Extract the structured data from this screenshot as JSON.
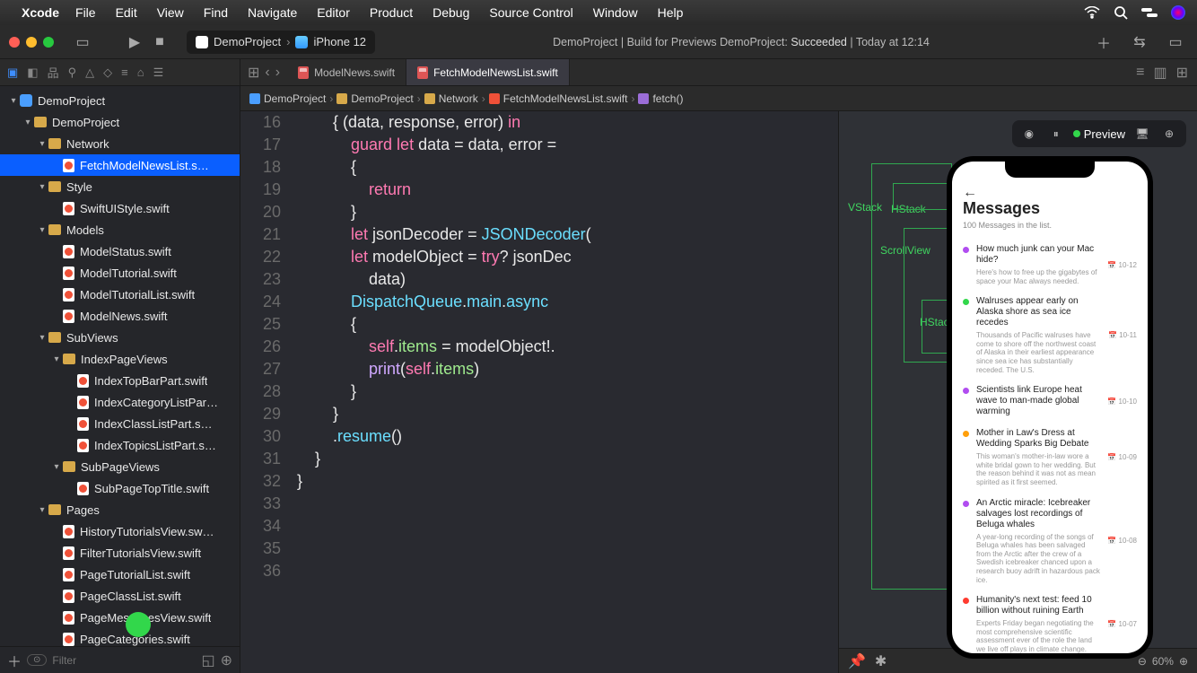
{
  "menubar": {
    "app": "Xcode",
    "items": [
      "File",
      "Edit",
      "View",
      "Find",
      "Navigate",
      "Editor",
      "Product",
      "Debug",
      "Source Control",
      "Window",
      "Help"
    ]
  },
  "toolbar": {
    "scheme_project": "DemoProject",
    "scheme_device": "iPhone 12",
    "status_left": "DemoProject | Build for Previews DemoProject:",
    "status_result": "Succeeded",
    "status_sep": "|",
    "status_time": "Today at 12:14"
  },
  "tabs": {
    "inactive": "ModelNews.swift",
    "active": "FetchModelNewsList.swift"
  },
  "breadcrumb": {
    "items": [
      "DemoProject",
      "DemoProject",
      "Network",
      "FetchModelNewsList.swift",
      "fetch()"
    ]
  },
  "tree": [
    {
      "d": 0,
      "t": "proj",
      "label": "DemoProject",
      "open": true
    },
    {
      "d": 1,
      "t": "folder",
      "label": "DemoProject",
      "open": true
    },
    {
      "d": 2,
      "t": "folder",
      "label": "Network",
      "open": true
    },
    {
      "d": 3,
      "t": "swift",
      "label": "FetchModelNewsList.s…",
      "selected": true
    },
    {
      "d": 2,
      "t": "folder",
      "label": "Style",
      "open": true
    },
    {
      "d": 3,
      "t": "swift",
      "label": "SwiftUIStyle.swift"
    },
    {
      "d": 2,
      "t": "folder",
      "label": "Models",
      "open": true
    },
    {
      "d": 3,
      "t": "swift",
      "label": "ModelStatus.swift"
    },
    {
      "d": 3,
      "t": "swift",
      "label": "ModelTutorial.swift"
    },
    {
      "d": 3,
      "t": "swift",
      "label": "ModelTutorialList.swift"
    },
    {
      "d": 3,
      "t": "swift",
      "label": "ModelNews.swift"
    },
    {
      "d": 2,
      "t": "folder",
      "label": "SubViews",
      "open": true
    },
    {
      "d": 3,
      "t": "folder",
      "label": "IndexPageViews",
      "open": true
    },
    {
      "d": 4,
      "t": "swift",
      "label": "IndexTopBarPart.swift"
    },
    {
      "d": 4,
      "t": "swift",
      "label": "IndexCategoryListPar…"
    },
    {
      "d": 4,
      "t": "swift",
      "label": "IndexClassListPart.s…"
    },
    {
      "d": 4,
      "t": "swift",
      "label": "IndexTopicsListPart.s…"
    },
    {
      "d": 3,
      "t": "folder",
      "label": "SubPageViews",
      "open": true
    },
    {
      "d": 4,
      "t": "swift",
      "label": "SubPageTopTitle.swift"
    },
    {
      "d": 2,
      "t": "folder",
      "label": "Pages",
      "open": true
    },
    {
      "d": 3,
      "t": "swift",
      "label": "HistoryTutorialsView.sw…"
    },
    {
      "d": 3,
      "t": "swift",
      "label": "FilterTutorialsView.swift"
    },
    {
      "d": 3,
      "t": "swift",
      "label": "PageTutorialList.swift"
    },
    {
      "d": 3,
      "t": "swift",
      "label": "PageClassList.swift"
    },
    {
      "d": 3,
      "t": "swift",
      "label": "PageMessagesView.swift"
    },
    {
      "d": 3,
      "t": "swift",
      "label": "PageCategories.swift"
    }
  ],
  "filter_placeholder": "Filter",
  "code": {
    "first_line": 16,
    "lines": [
      [
        {
          "c": "plain",
          "t": "        { (data, response, error) "
        },
        {
          "c": "k-pink",
          "t": "in"
        }
      ],
      [
        {
          "c": "plain",
          "t": "            "
        },
        {
          "c": "k-pink",
          "t": "guard let"
        },
        {
          "c": "plain",
          "t": " data = data, error ="
        }
      ],
      [
        {
          "c": "plain",
          "t": "            {"
        }
      ],
      [
        {
          "c": "plain",
          "t": "                "
        },
        {
          "c": "k-pink",
          "t": "return"
        }
      ],
      [
        {
          "c": "plain",
          "t": "            }"
        }
      ],
      [
        {
          "c": "plain",
          "t": ""
        }
      ],
      [
        {
          "c": "plain",
          "t": "            "
        },
        {
          "c": "k-pink",
          "t": "let"
        },
        {
          "c": "plain",
          "t": " jsonDecoder = "
        },
        {
          "c": "k-teal",
          "t": "JSONDecoder"
        },
        {
          "c": "plain",
          "t": "("
        }
      ],
      [
        {
          "c": "plain",
          "t": "            "
        },
        {
          "c": "k-pink",
          "t": "let"
        },
        {
          "c": "plain",
          "t": " modelObject = "
        },
        {
          "c": "k-pink",
          "t": "try"
        },
        {
          "c": "plain",
          "t": "? jsonDec"
        }
      ],
      [
        {
          "c": "plain",
          "t": "                data)"
        }
      ],
      [
        {
          "c": "plain",
          "t": ""
        }
      ],
      [
        {
          "c": "plain",
          "t": "            "
        },
        {
          "c": "k-teal",
          "t": "DispatchQueue"
        },
        {
          "c": "plain",
          "t": "."
        },
        {
          "c": "k-teal",
          "t": "main"
        },
        {
          "c": "plain",
          "t": "."
        },
        {
          "c": "k-teal",
          "t": "async"
        }
      ],
      [
        {
          "c": "plain",
          "t": "            {"
        }
      ],
      [
        {
          "c": "plain",
          "t": "                "
        },
        {
          "c": "k-pink",
          "t": "self"
        },
        {
          "c": "plain",
          "t": "."
        },
        {
          "c": "k-green",
          "t": "items"
        },
        {
          "c": "plain",
          "t": " = modelObject!."
        }
      ],
      [
        {
          "c": "plain",
          "t": "                "
        },
        {
          "c": "k-purple",
          "t": "print"
        },
        {
          "c": "plain",
          "t": "("
        },
        {
          "c": "k-pink",
          "t": "self"
        },
        {
          "c": "plain",
          "t": "."
        },
        {
          "c": "k-green",
          "t": "items"
        },
        {
          "c": "plain",
          "t": ")"
        }
      ],
      [
        {
          "c": "plain",
          "t": "            }"
        }
      ],
      [
        {
          "c": "plain",
          "t": ""
        }
      ],
      [
        {
          "c": "plain",
          "t": "        }"
        }
      ],
      [
        {
          "c": "plain",
          "t": "        ."
        },
        {
          "c": "k-teal",
          "t": "resume"
        },
        {
          "c": "plain",
          "t": "()"
        }
      ],
      [
        {
          "c": "plain",
          "t": "    }"
        }
      ],
      [
        {
          "c": "plain",
          "t": "}"
        }
      ],
      [
        {
          "c": "plain",
          "t": ""
        }
      ]
    ]
  },
  "preview": {
    "preview_label": "Preview",
    "labels": {
      "vstack": "VStack",
      "hstack": "HStack",
      "scrollview": "ScrollView",
      "hstack2": "HStack"
    },
    "phone": {
      "title": "Messages",
      "subtitle": "100 Messages in the list.",
      "messages": [
        {
          "color": "#b14df0",
          "title": "How much junk can your Mac hide?",
          "desc": "Here's how to free up the gigabytes of space your Mac always needed.",
          "date": "10-12"
        },
        {
          "color": "#32d74b",
          "title": "Walruses appear early on Alaska shore as sea ice recedes",
          "desc": "Thousands of Pacific walruses have come to shore off the northwest coast of Alaska in their earliest appearance since sea ice has substantially receded. The U.S.",
          "date": "10-11"
        },
        {
          "color": "#b14df0",
          "title": "Scientists link Europe heat wave to man-made global warming",
          "desc": "",
          "date": "10-10"
        },
        {
          "color": "#ff9f0a",
          "title": "Mother in Law's Dress at Wedding Sparks Big Debate",
          "desc": "This woman's mother-in-law wore a white bridal gown to her wedding. But the reason behind it was not as mean spirited as it first seemed.",
          "date": "10-09"
        },
        {
          "color": "#b14df0",
          "title": "An Arctic miracle: Icebreaker salvages lost recordings of Beluga whales",
          "desc": "A year-long recording of the songs of Beluga whales has been salvaged from the Arctic after the crew of a Swedish icebreaker chanced upon a research buoy adrift in hazardous pack ice.",
          "date": "10-08"
        },
        {
          "color": "#ff3b30",
          "title": "Humanity's next test: feed 10 billion without ruining Earth",
          "desc": "Experts Friday began negotiating the most comprehensive scientific assessment ever of the role the land we live off plays in climate change.",
          "date": "10-07"
        }
      ]
    },
    "zoom": "60%"
  }
}
